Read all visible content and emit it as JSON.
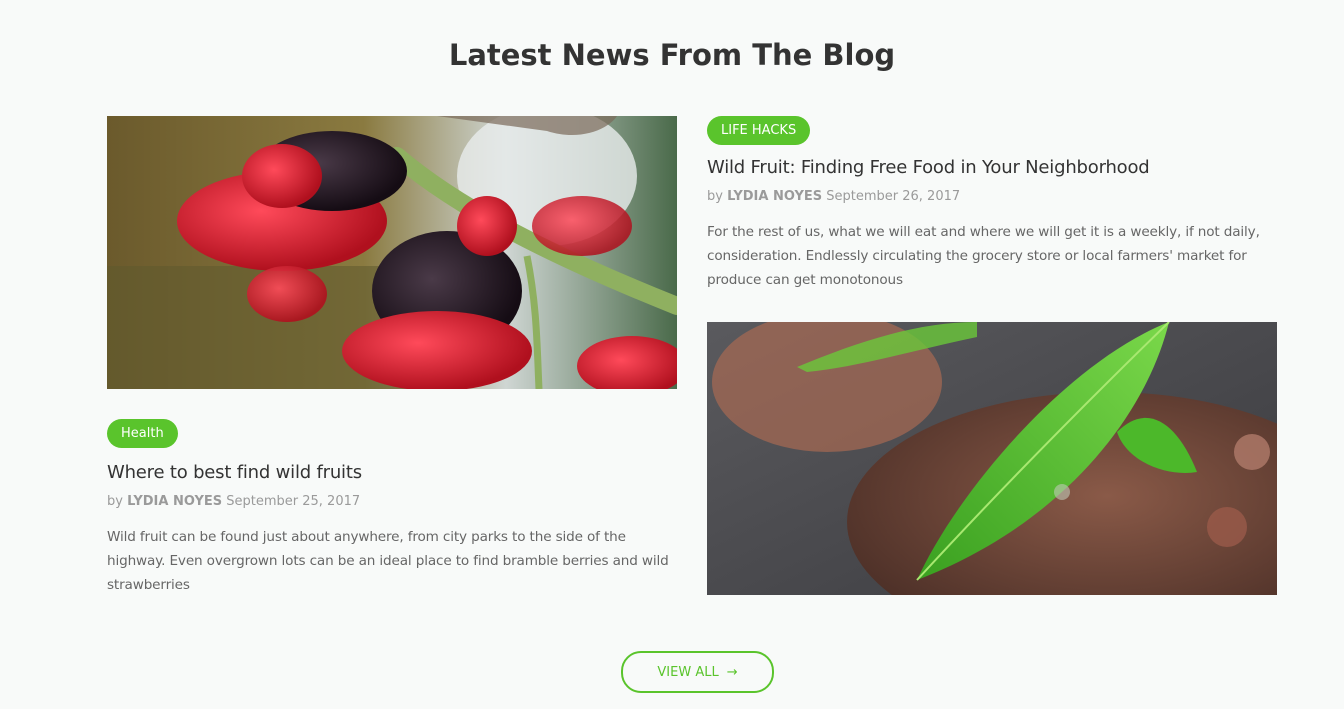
{
  "section": {
    "title": "Latest News From The Blog"
  },
  "posts": [
    {
      "category": "Health",
      "title": "Where to best find wild fruits",
      "by": "by",
      "author": "LYDIA NOYES",
      "date": "September 25, 2017",
      "excerpt": "Wild fruit can be found just about anywhere, from city parks to the side of the highway. Even overgrown lots can be an ideal place to find bramble berries and wild strawberries",
      "image": "mulberries-photo"
    },
    {
      "category": "LIFE HACKS",
      "title": "Wild Fruit: Finding Free Food in Your Neighborhood",
      "by": "by",
      "author": "LYDIA NOYES",
      "date": "September 26, 2017",
      "excerpt": "For the rest of us, what we will eat and where we will get it is a weekly, if not daily, consideration. Endlessly circulating the grocery store or local farmers' market for produce can get monotonous",
      "image": "leaves-on-stone-photo"
    }
  ],
  "view_all": {
    "label": "VIEW ALL",
    "arrow": "→"
  },
  "colors": {
    "accent": "#5ac42c",
    "background": "#f8faf9",
    "title": "#333333"
  }
}
